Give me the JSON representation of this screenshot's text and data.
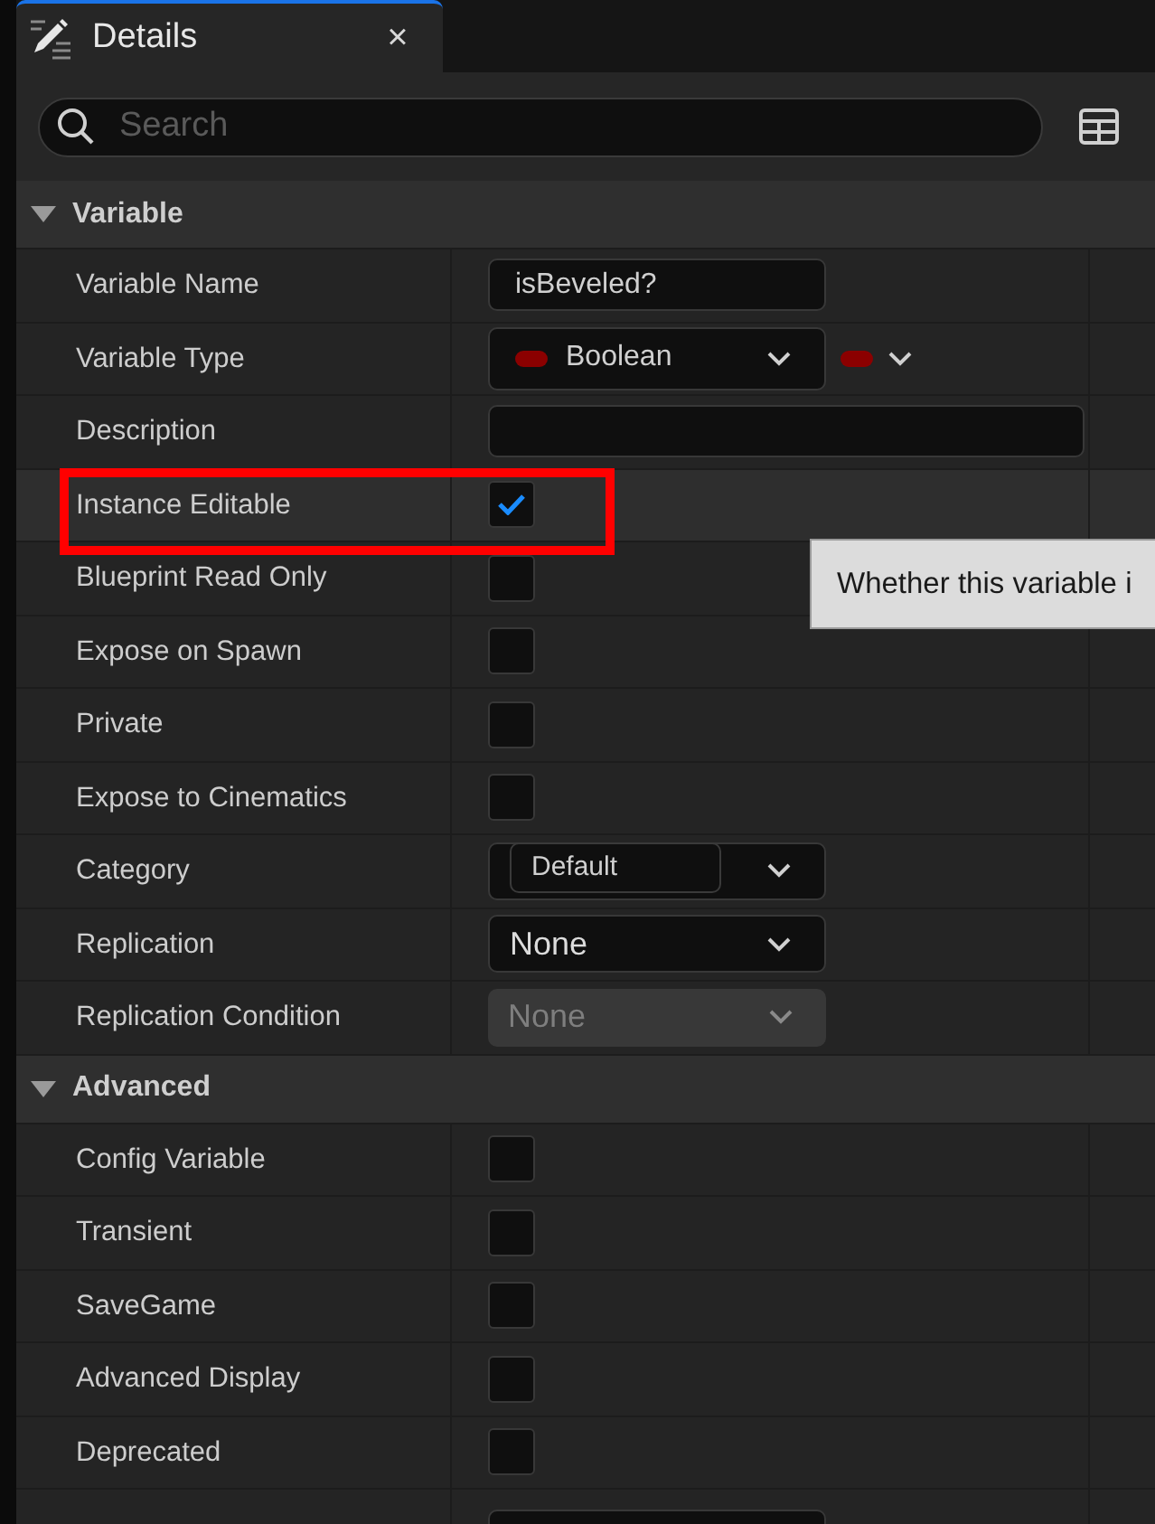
{
  "tab": {
    "title": "Details",
    "close": "×"
  },
  "search": {
    "placeholder": "Search"
  },
  "sections": [
    {
      "title": "Variable",
      "expanded": true,
      "rows": [
        {
          "label": "Variable Name",
          "kind": "text",
          "value": "isBeveled?"
        },
        {
          "label": "Variable Type",
          "kind": "type",
          "value": "Boolean",
          "color": "#8b0000"
        },
        {
          "label": "Description",
          "kind": "text",
          "value": ""
        },
        {
          "label": "Instance Editable",
          "kind": "checkbox",
          "checked": true,
          "highlighted": true
        },
        {
          "label": "Blueprint Read Only",
          "kind": "checkbox",
          "checked": false,
          "highlighted": false
        },
        {
          "label": "Expose on Spawn",
          "kind": "checkbox",
          "checked": false,
          "highlighted": false
        },
        {
          "label": "Private",
          "kind": "checkbox",
          "checked": false,
          "highlighted": false
        },
        {
          "label": "Expose to Cinematics",
          "kind": "checkbox",
          "checked": false,
          "highlighted": false
        },
        {
          "label": "Category",
          "kind": "combo",
          "value": "Default"
        },
        {
          "label": "Replication",
          "kind": "dropdown",
          "value": "None",
          "disabled": false
        },
        {
          "label": "Replication Condition",
          "kind": "dropdown",
          "value": "None",
          "disabled": true
        }
      ]
    },
    {
      "title": "Advanced",
      "expanded": true,
      "rows": [
        {
          "label": "Config Variable",
          "kind": "checkbox",
          "checked": false,
          "highlighted": false
        },
        {
          "label": "Transient",
          "kind": "checkbox",
          "checked": false,
          "highlighted": false
        },
        {
          "label": "SaveGame",
          "kind": "checkbox",
          "checked": false,
          "highlighted": false
        },
        {
          "label": "Advanced Display",
          "kind": "checkbox",
          "checked": false,
          "highlighted": false
        },
        {
          "label": "Deprecated",
          "kind": "checkbox",
          "checked": false,
          "highlighted": false
        },
        {
          "label": "",
          "kind": "text",
          "value": ""
        }
      ]
    }
  ],
  "tooltip": {
    "text": "Whether this variable i"
  }
}
